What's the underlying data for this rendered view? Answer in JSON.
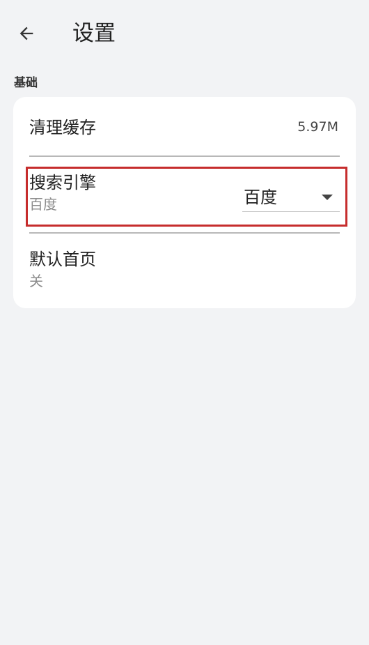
{
  "appbar": {
    "back_icon": "arrow-left-icon",
    "title": "设置"
  },
  "section": {
    "label": "基础"
  },
  "settings": {
    "clear_cache": {
      "title": "清理缓存",
      "value": "5.97M"
    },
    "search_engine": {
      "title": "搜索引擎",
      "subtitle": "百度",
      "selected": "百度",
      "dropdown_icon": "caret-down-icon"
    },
    "default_homepage": {
      "title": "默认首页",
      "subtitle": "关"
    }
  },
  "colors": {
    "background": "#f2f3f5",
    "card": "#ffffff",
    "highlight_border": "#c62d2d",
    "subtitle_text": "#8c8c8c"
  }
}
